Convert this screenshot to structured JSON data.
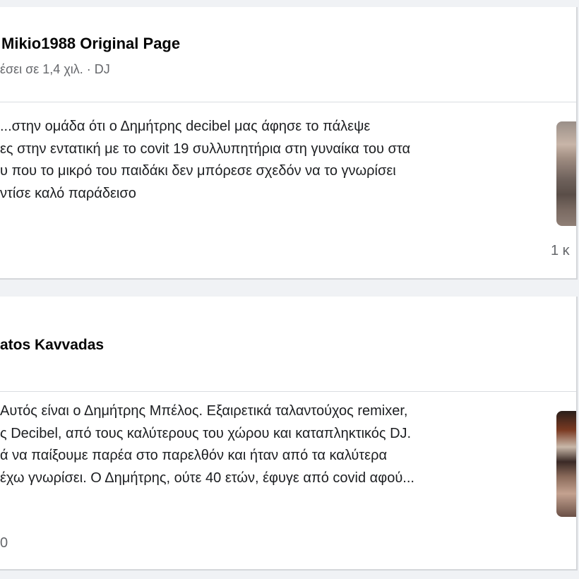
{
  "posts": [
    {
      "page_name": "Mikio1988 Original Page",
      "meta_reach": "έσει σε 1,4 χιλ.",
      "meta_sep": " · ",
      "meta_category": "DJ",
      "body_lines": [
        "...στην ομάδα ότι ο Δημήτρης decibel μας άφησε το πάλεψε",
        "ες στην εντατική με το covit 19 συλλυπητήρια στη γυναίκα του στα",
        "υ που το μικρό του παιδάκι δεν μπόρεσε σχεδόν να το γνωρίσει",
        "ντίσε καλό παράδεισο"
      ],
      "count": "1 κ"
    },
    {
      "page_name": "atos Kavvadas",
      "body_lines": [
        "Αυτός είναι ο Δημήτρης Μπέλος. Εξαιρετικά ταλαντούχος remixer,",
        "ς Decibel, από τους καλύτερους του χώρου και καταπληκτικός DJ.",
        "ά να παίξουμε παρέα στο παρελθόν και ήταν από τα καλύτερα",
        "έχω γνωρίσει. Ο Δημήτρης, ούτε 40 ετών, έφυγε από covid αφού..."
      ],
      "count": "0"
    }
  ]
}
